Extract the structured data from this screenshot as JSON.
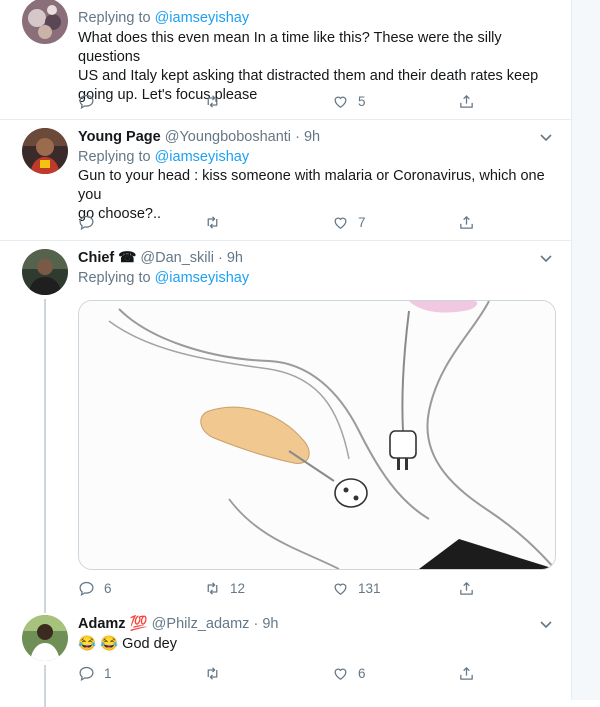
{
  "tweets": [
    {
      "replying_label": "Replying to",
      "replying_to": "@iamseyishay",
      "text_lines": [
        "What does this even mean In a time like this? These were the silly questions",
        "US and Italy kept asking that distracted them and their death rates keep",
        "going up. Let's focus please"
      ],
      "likes": "5"
    },
    {
      "name": "Young Page",
      "handle": "@Youngboboshanti",
      "dot": "·",
      "time": "9h",
      "replying_label": "Replying to",
      "replying_to": "@iamseyishay",
      "text_lines": [
        "Gun to your head : kiss someone with malaria or Coronavirus, which one you",
        "go choose?.."
      ],
      "likes": "7"
    },
    {
      "name": "Chief",
      "name_emoji": "☎",
      "handle": "@Dan_skili",
      "dot": "·",
      "time": "9h",
      "replying_label": "Replying to",
      "replying_to": "@iamseyishay",
      "replies": "6",
      "retweets": "12",
      "likes": "131"
    },
    {
      "name": "Adamz",
      "name_emoji": "💯",
      "handle": "@Philz_adamz",
      "dot": "·",
      "time": "9h",
      "text": "😂 😂 God dey",
      "replies": "1",
      "likes": "6"
    }
  ],
  "colors": {
    "accent": "#1da1f2",
    "muted": "#657786",
    "border": "#e6ecf0"
  }
}
